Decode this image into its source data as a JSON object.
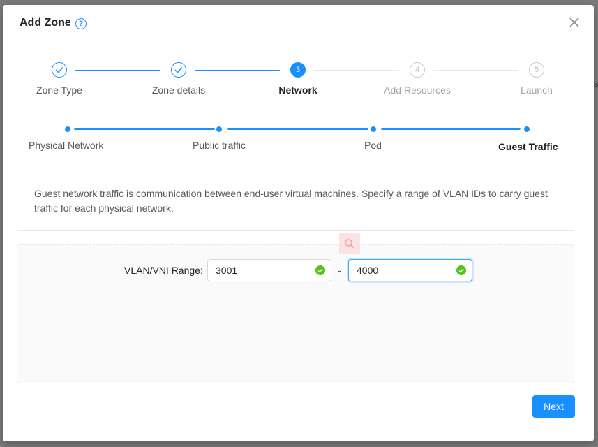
{
  "dialog": {
    "title": "Add Zone",
    "close_icon": "close-icon",
    "help_icon": "question-circle-icon"
  },
  "steps": [
    {
      "label": "Zone Type",
      "state": "done"
    },
    {
      "label": "Zone details",
      "state": "done"
    },
    {
      "label": "Network",
      "number": "3",
      "state": "active"
    },
    {
      "label": "Add Resources",
      "number": "4",
      "state": "wait"
    },
    {
      "label": "Launch",
      "number": "5",
      "state": "wait"
    }
  ],
  "sub_steps": [
    {
      "label": "Physical Network"
    },
    {
      "label": "Public traffic"
    },
    {
      "label": "Pod"
    },
    {
      "label": "Guest Traffic"
    }
  ],
  "info_text": "Guest network traffic is communication between end-user virtual machines. Specify a range of VLAN IDs to carry guest traffic for each physical network.",
  "form": {
    "vlan_label": "VLAN/VNI Range",
    "vlan_start": "3001",
    "separator": "-",
    "vlan_end": "4000"
  },
  "footer": {
    "next_label": "Next"
  },
  "colors": {
    "primary": "#1890ff",
    "success": "#52c41a"
  }
}
